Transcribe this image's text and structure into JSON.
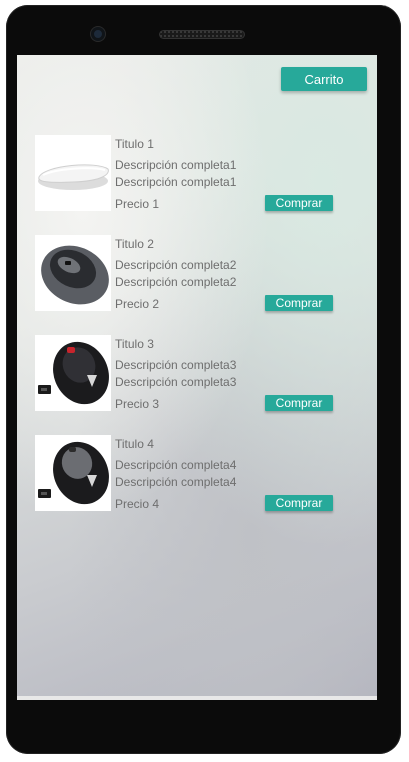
{
  "header": {
    "cart_label": "Carrito"
  },
  "accent_color": "#27a99a",
  "products": [
    {
      "title": "Titulo 1",
      "desc_line1": "Descripción completa1",
      "desc_line2": "Descripción completa1",
      "price": "Precio 1",
      "buy_label": "Comprar",
      "image": "white-apple-mouse"
    },
    {
      "title": "Titulo 2",
      "desc_line1": "Descripción completa2",
      "desc_line2": "Descripción completa2",
      "price": "Precio 2",
      "buy_label": "Comprar",
      "image": "gray-logitech-mouse"
    },
    {
      "title": "Titulo 3",
      "desc_line1": "Descripción completa3",
      "desc_line2": "Descripción completa3",
      "price": "Precio 3",
      "buy_label": "Comprar",
      "image": "black-red-wireless-mouse"
    },
    {
      "title": "Titulo 4",
      "desc_line1": "Descripción completa4",
      "desc_line2": "Descripción completa4",
      "price": "Precio 4",
      "buy_label": "Comprar",
      "image": "black-gray-wireless-mouse"
    }
  ]
}
